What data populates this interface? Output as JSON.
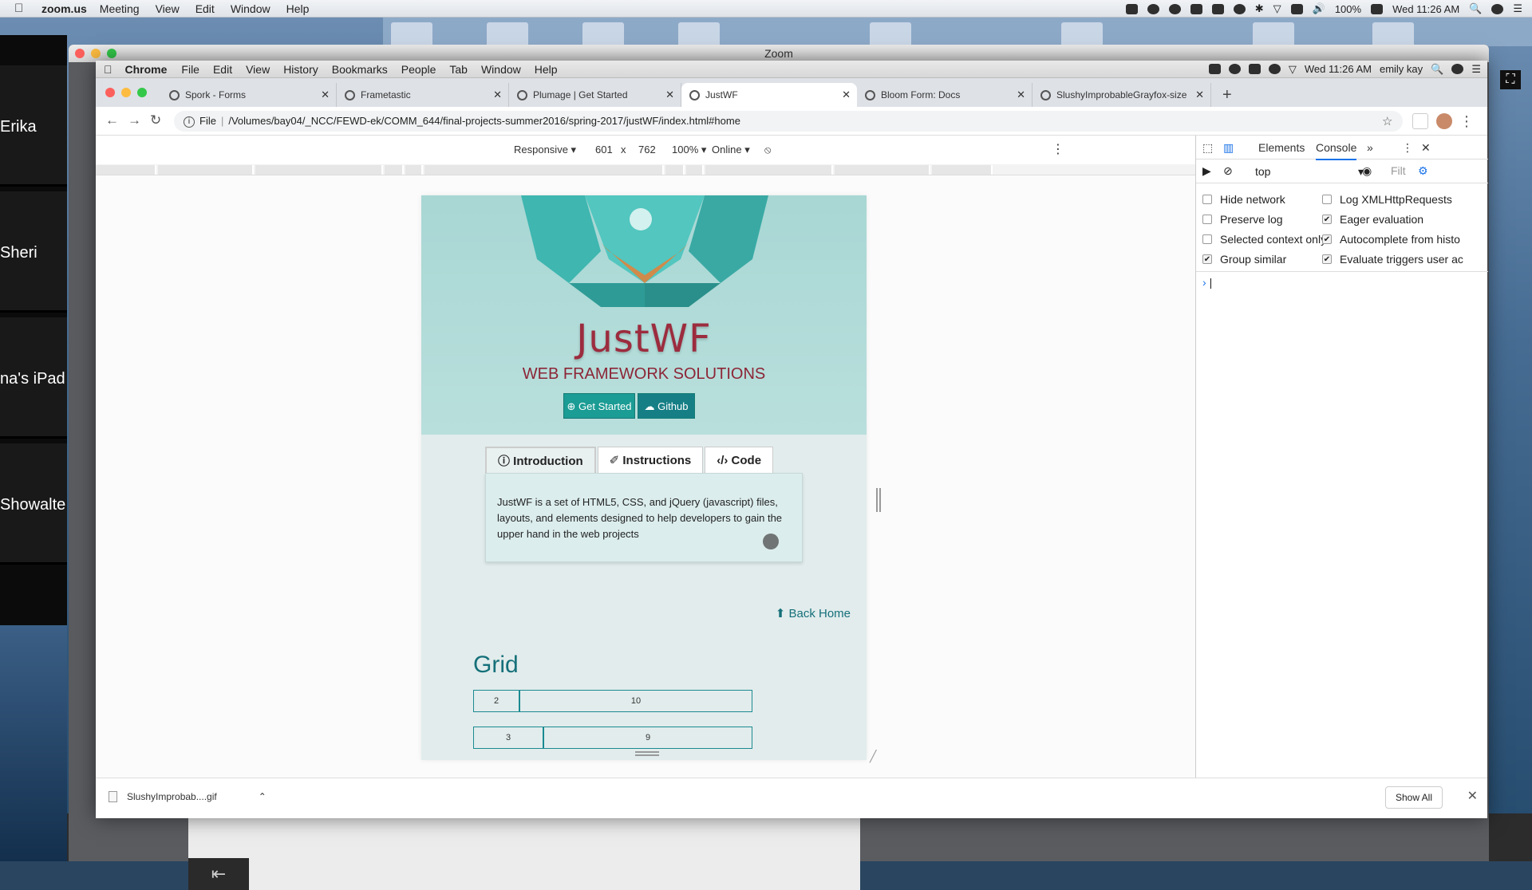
{
  "mac_menubar": {
    "app": "zoom.us",
    "items": [
      "Meeting",
      "View",
      "Edit",
      "Window",
      "Help"
    ],
    "battery": "100%",
    "clock": "Wed 11:26 AM"
  },
  "zoom": {
    "window_title": "Zoom",
    "participants": [
      "Erika",
      "Sheri",
      "na's iPad",
      "Showalte"
    ],
    "exit_icon": "⇤"
  },
  "chrome_menubar": {
    "app": "Chrome",
    "items": [
      "File",
      "Edit",
      "View",
      "History",
      "Bookmarks",
      "People",
      "Tab",
      "Window",
      "Help"
    ],
    "clock": "Wed 11:26 AM",
    "user": "emily kay"
  },
  "tabs": [
    {
      "title": "Spork - Forms"
    },
    {
      "title": "Frametastic"
    },
    {
      "title": "Plumage | Get Started"
    },
    {
      "title": "JustWF"
    },
    {
      "title": "Bloom Form: Docs"
    },
    {
      "title": "SlushyImprobableGrayfox-size"
    }
  ],
  "toolbar": {
    "scheme": "File",
    "url": "/Volumes/bay04/_NCC/FEWD-ek/COMM_644/final-projects-summer2016/spring-2017/justWF/index.html#home"
  },
  "device_toolbar": {
    "mode": "Responsive",
    "width": "601",
    "times": "x",
    "height": "762",
    "zoom": "100%",
    "network": "Online"
  },
  "page": {
    "brand": "JustWF",
    "tagline": "WEB FRAMEWORK SOLUTIONS",
    "get_started": "⊕ Get Started",
    "github": "☁ Github",
    "tabs": [
      "ⓘ Introduction",
      "✐ Instructions",
      "‹/› Code"
    ],
    "intro_text": "JustWF is a set of HTML5, CSS, and jQuery (javascript) files, layouts, and elements designed to help developers to gain the upper hand in the web projects",
    "back_home": "⬆ Back Home",
    "grid_title": "Grid",
    "grid_rows": [
      [
        "2",
        "10"
      ],
      [
        "3",
        "9"
      ]
    ]
  },
  "devtools": {
    "tabs": [
      "Elements",
      "Console"
    ],
    "active_tab": "Console",
    "more": "»",
    "context": "top",
    "filter_placeholder": "Filt",
    "options_left": [
      {
        "label": "Hide network",
        "checked": false
      },
      {
        "label": "Preserve log",
        "checked": false
      },
      {
        "label": "Selected context only",
        "checked": false
      },
      {
        "label": "Group similar",
        "checked": true
      }
    ],
    "options_right": [
      {
        "label": "Log XMLHttpRequests",
        "checked": false
      },
      {
        "label": "Eager evaluation",
        "checked": true
      },
      {
        "label": "Autocomplete from histo",
        "checked": true
      },
      {
        "label": "Evaluate triggers user ac",
        "checked": true
      }
    ],
    "prompt": "›"
  },
  "downloads": {
    "file": "SlushyImprobab....gif",
    "show_all": "Show All"
  },
  "colors": {
    "brand": "#9c2c3e",
    "teal": "#1b9c94",
    "link": "#15707a",
    "devtools_accent": "#1a73e8"
  }
}
